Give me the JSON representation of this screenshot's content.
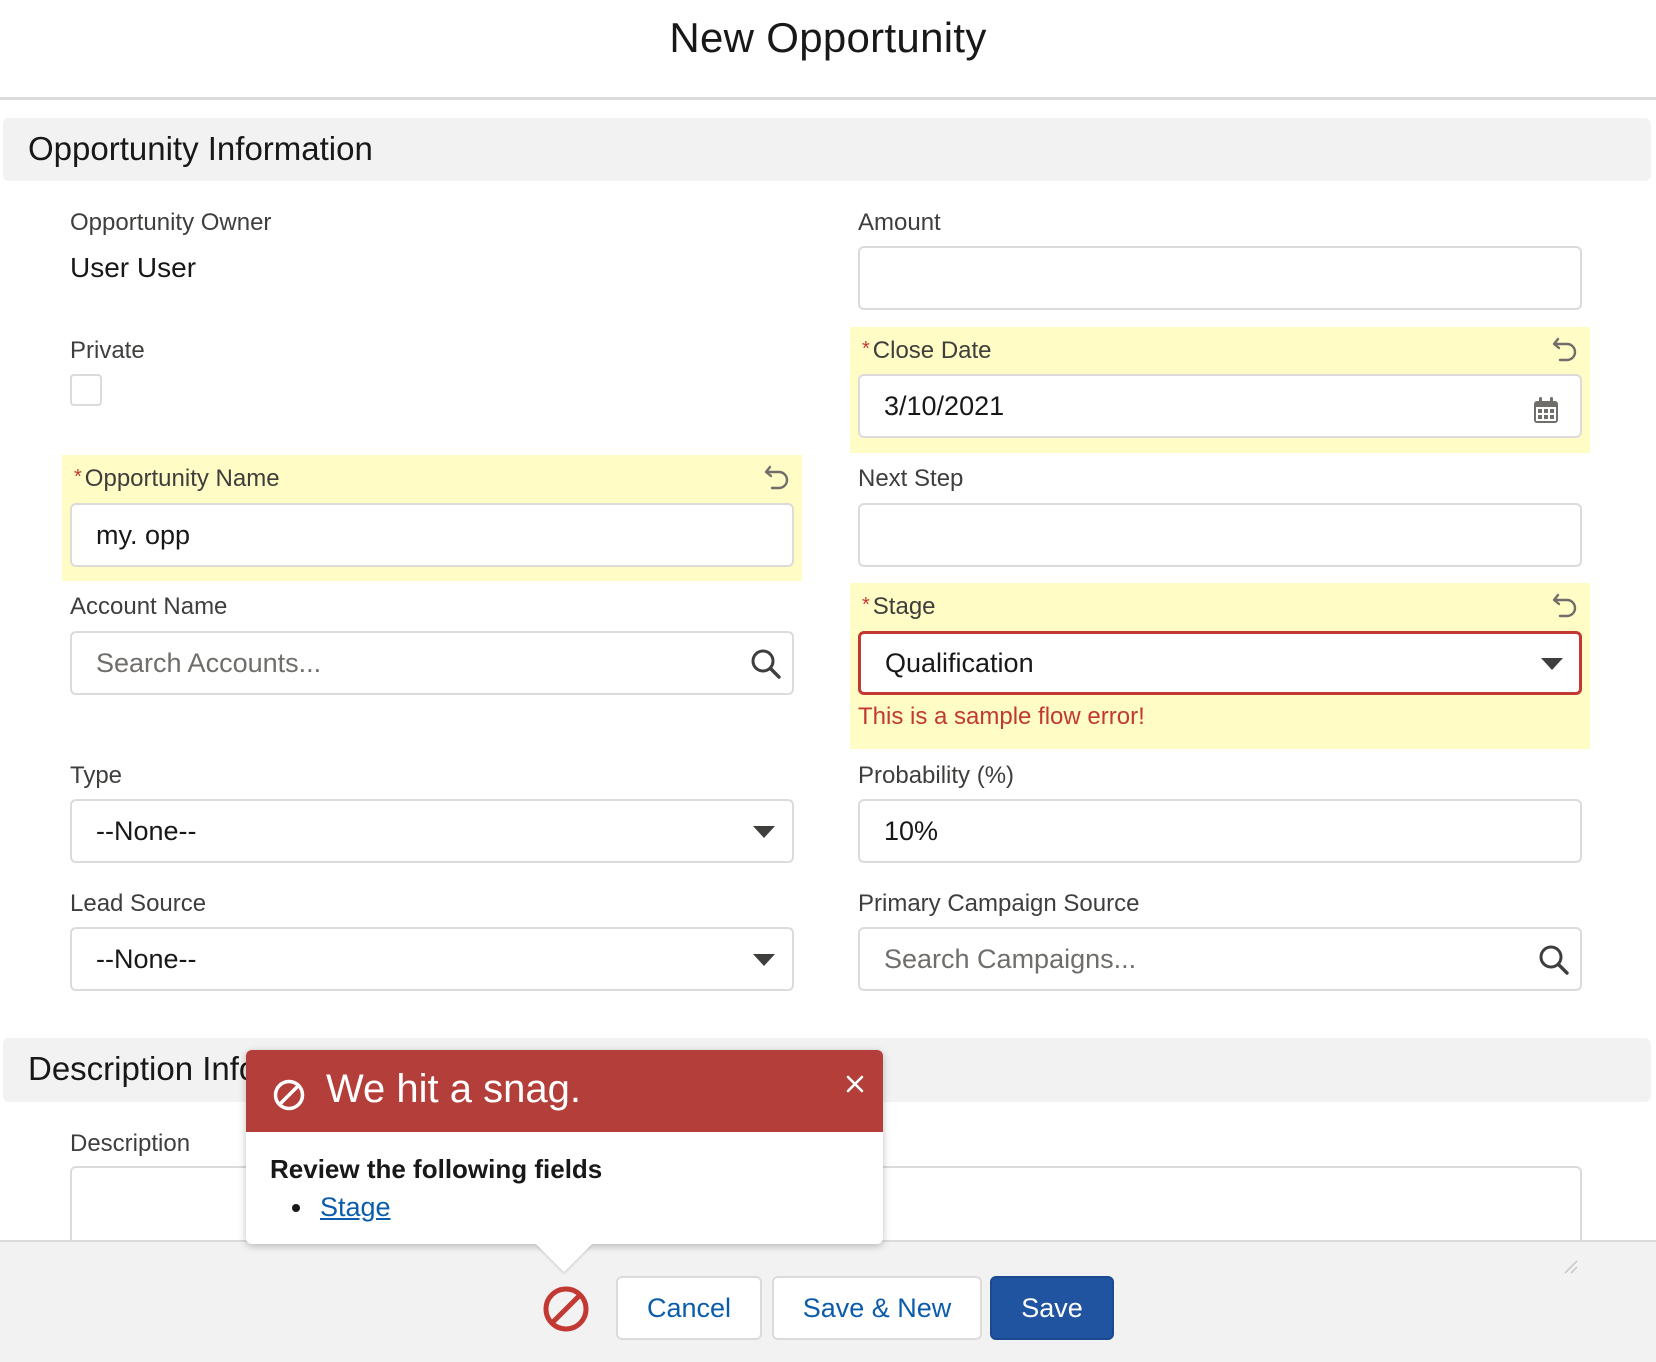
{
  "modal": {
    "title": "New Opportunity"
  },
  "sections": {
    "opportunity_info": "Opportunity Information",
    "description_info": "Description Information"
  },
  "fields": {
    "owner": {
      "label": "Opportunity Owner",
      "value": "User User"
    },
    "private": {
      "label": "Private",
      "checked": false
    },
    "opp_name": {
      "label": "Opportunity Name",
      "value": "my. opp",
      "required": "*"
    },
    "account": {
      "label": "Account Name",
      "placeholder": "Search Accounts..."
    },
    "type": {
      "label": "Type",
      "value": "--None--"
    },
    "lead_source": {
      "label": "Lead Source",
      "value": "--None--"
    },
    "amount": {
      "label": "Amount",
      "value": ""
    },
    "close_date": {
      "label": "Close Date",
      "value": "3/10/2021",
      "required": "*"
    },
    "next_step": {
      "label": "Next Step",
      "value": ""
    },
    "stage": {
      "label": "Stage",
      "value": "Qualification",
      "required": "*",
      "error": "This is a sample flow error!"
    },
    "probability": {
      "label": "Probability (%)",
      "value": "10%"
    },
    "campaign": {
      "label": "Primary Campaign Source",
      "placeholder": "Search Campaigns..."
    },
    "description": {
      "label": "Description",
      "value": ""
    }
  },
  "popover": {
    "title": "We hit a snag.",
    "body_title": "Review the following fields",
    "items": [
      "Stage"
    ]
  },
  "footer": {
    "cancel": "Cancel",
    "save_new": "Save & New",
    "save": "Save"
  },
  "colors": {
    "brand": "#2053a0",
    "error": "#c23934",
    "highlight": "#fffcc5",
    "popover_header": "#b43f3a"
  }
}
